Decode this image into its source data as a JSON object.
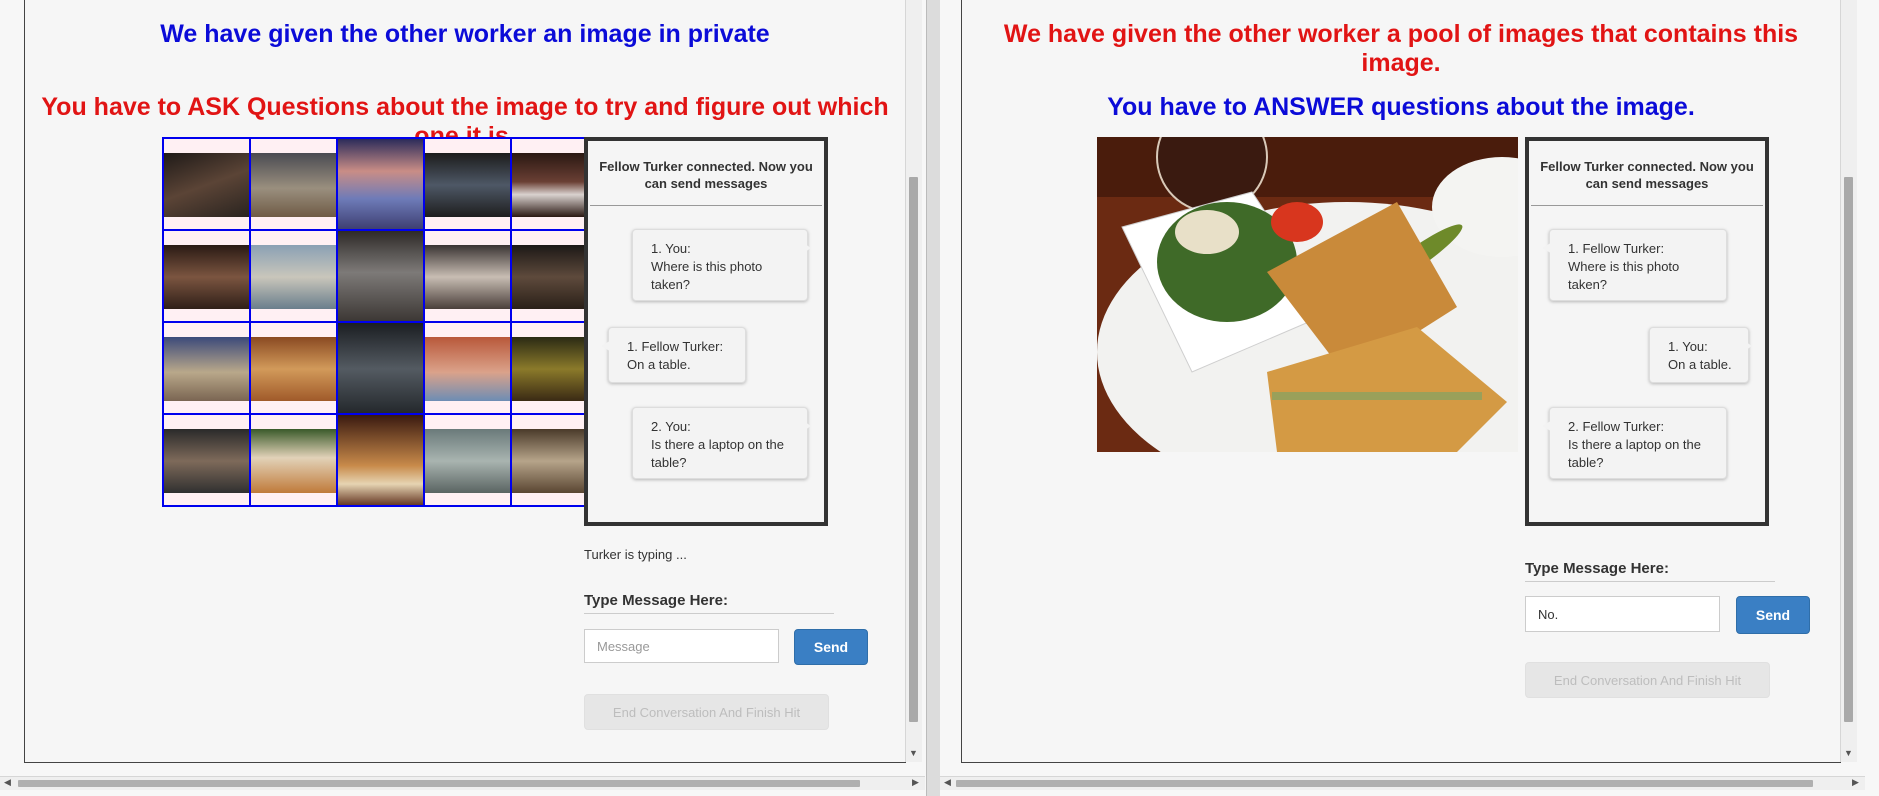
{
  "left": {
    "heading_top": "We have given the other worker an image in private",
    "heading_bottom": "You have to ASK Questions about the image to try and figure out which one it is.",
    "grid_icons": [
      "photo-thumbnail-icon"
    ],
    "chat": {
      "header": "Fellow Turker connected. Now you can send messages",
      "messages": [
        {
          "speaker": "1. You:",
          "text": "Where is this photo taken?"
        },
        {
          "speaker": "1. Fellow Turker:",
          "text": "On a table."
        },
        {
          "speaker": "2. You:",
          "text": "Is there a laptop on the table?"
        }
      ]
    },
    "typing_status": "Turker is typing ...",
    "type_label": "Type Message Here:",
    "input_value": "",
    "input_placeholder": "Message",
    "send_label": "Send",
    "end_label": "End Conversation And Finish Hit"
  },
  "right": {
    "heading_top": "We have given the other worker a pool of images that contains this image.",
    "heading_bottom": "You have to ANSWER questions about the image.",
    "chat": {
      "header": "Fellow Turker connected. Now you can send messages",
      "messages": [
        {
          "speaker": "1. Fellow Turker:",
          "text": "Where is this photo taken?"
        },
        {
          "speaker": "1. You:",
          "text": "On a table."
        },
        {
          "speaker": "2. Fellow Turker:",
          "text": "Is there a laptop on the table?"
        }
      ]
    },
    "type_label": "Type Message Here:",
    "input_value": "No.",
    "send_label": "Send",
    "end_label": "End Conversation And Finish Hit"
  },
  "colors": {
    "blue_heading": "#0b0bd8",
    "red_heading": "#e11414",
    "send_button": "#3a7fc4"
  }
}
